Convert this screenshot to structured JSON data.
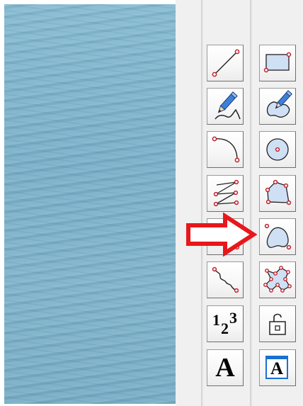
{
  "workspace": {
    "background": "#7fb4cc"
  },
  "toolbar": {
    "highlight_color": "#e8171b",
    "accent_color": "#1a6fd0",
    "left_column": [
      {
        "name": "line-tool",
        "icon": "line-icon"
      },
      {
        "name": "freehand-pencil-tool",
        "icon": "pencil-curve-icon"
      },
      {
        "name": "arc-tool",
        "icon": "arc-icon"
      },
      {
        "name": "polyline-tool",
        "icon": "polyline-icon"
      },
      {
        "name": "curve-tool",
        "icon": "bezier-curve-icon"
      },
      {
        "name": "zigzag-tool",
        "icon": "zigzag-icon"
      },
      {
        "name": "numbering-tool",
        "icon": "numbering-icon",
        "glyph": {
          "one": "1",
          "two": "2",
          "three": "3"
        }
      },
      {
        "name": "text-tool",
        "icon": "text-icon",
        "glyph": "A"
      }
    ],
    "right_column": [
      {
        "name": "rectangle-tool",
        "icon": "rectangle-icon"
      },
      {
        "name": "freehand-shape-tool",
        "icon": "pencil-shape-icon"
      },
      {
        "name": "circle-tool",
        "icon": "circle-icon"
      },
      {
        "name": "polygon-tool",
        "icon": "polygon-icon"
      },
      {
        "name": "closed-curve-tool",
        "icon": "closed-curve-icon"
      },
      {
        "name": "cross-shape-tool",
        "icon": "cross-shape-icon"
      },
      {
        "name": "lock-tool",
        "icon": "lock-icon"
      },
      {
        "name": "text-box-tool",
        "icon": "text-box-icon",
        "glyph": "A"
      }
    ]
  },
  "annotation": {
    "icon": "red-arrow-icon",
    "points_to": "closed-curve-tool"
  }
}
